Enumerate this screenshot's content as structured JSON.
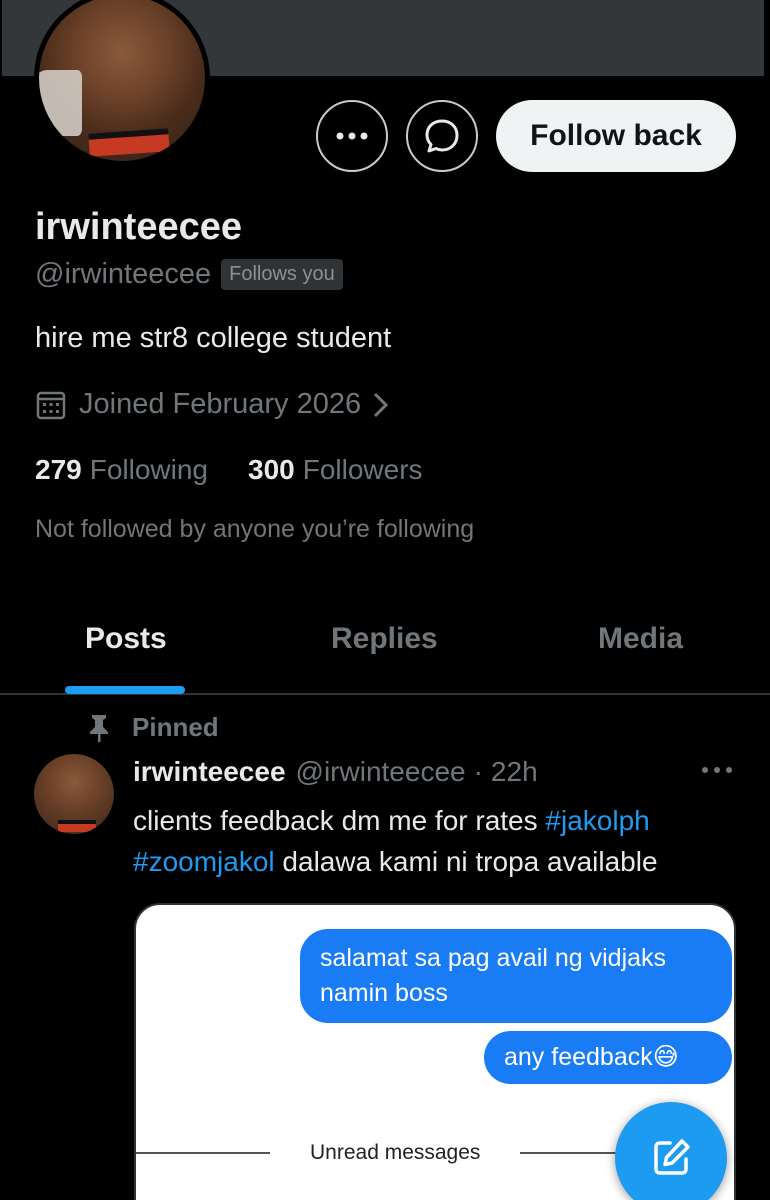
{
  "profile": {
    "display_name": "irwinteecee",
    "handle": "@irwinteecee",
    "follows_you_badge": "Follows you",
    "bio": "hire me str8 college student",
    "joined": "Joined February 2026",
    "following_count": "279",
    "following_label": "Following",
    "followers_count": "300",
    "followers_label": "Followers",
    "not_followed_text": "Not followed by anyone you’re following"
  },
  "actions": {
    "follow_back_label": "Follow back"
  },
  "tabs": [
    {
      "label": "Posts",
      "active": true
    },
    {
      "label": "Replies",
      "active": false
    },
    {
      "label": "Media",
      "active": false
    }
  ],
  "pinned_post": {
    "pinned_label": "Pinned",
    "author_name": "irwinteecee",
    "author_handle": "@irwinteecee",
    "separator": "·",
    "time": "22h",
    "text_before": "clients feedback dm me for rates ",
    "tag1": "#jakolph",
    "tag2": "#zoomjakol",
    "text_after": " dalawa kami ni tropa available",
    "media": {
      "bubble1": "salamat sa pag avail ng vidjaks namin boss",
      "bubble2": "any feedback😅",
      "unread_label": "Unread messages"
    }
  },
  "colors": {
    "accent": "#1d9bf0",
    "background": "#000000",
    "muted_text": "#71767b",
    "primary_text": "#e7e9ea"
  },
  "icons": [
    "more-horizontal-icon",
    "message-icon",
    "calendar-icon",
    "chevron-right-icon",
    "pin-icon",
    "compose-icon"
  ]
}
